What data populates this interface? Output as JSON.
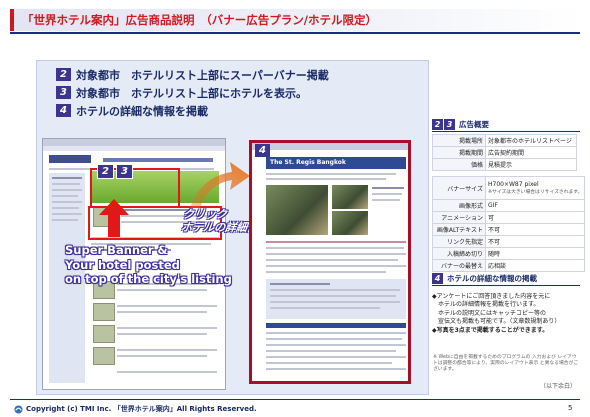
{
  "title": "「世界ホテル案内」広告商品説明　（バナー広告プラン/ホテル限定）",
  "steps": [
    {
      "num": "2",
      "text": "対象都市　ホテルリスト上部にスーパーバナー掲載"
    },
    {
      "num": "3",
      "text": "対象都市　ホテルリスト上部にホテルを表示。"
    },
    {
      "num": "4",
      "text": "ホテルの詳細な情報を掲載"
    }
  ],
  "left_screenshot": {
    "nums": [
      "2",
      "3"
    ]
  },
  "right_screenshot": {
    "num": "4",
    "hotel_name": "The St. Regis Bangkok"
  },
  "overlay": {
    "super_banner": [
      "Super Banner &",
      "Your hotel posted",
      "on top of the city's listing"
    ],
    "click": [
      "クリック",
      "ホテルの詳細情報を表示"
    ]
  },
  "overview": {
    "nums": [
      "2",
      "3"
    ],
    "heading": "広告概要",
    "rows": [
      {
        "k": "掲載場所",
        "v": "対象都市のホテルリストページ"
      },
      {
        "k": "掲載期間",
        "v": "広告契約期間"
      },
      {
        "k": "価格",
        "v": "見積提示"
      },
      {
        "k": "バナーサイズ",
        "v": "H700×W87 pixel",
        "note": "※サイズは大きい場合はリサイズされます。"
      },
      {
        "k": "画像形式",
        "v": "GIF"
      },
      {
        "k": "アニメーション",
        "v": "可"
      },
      {
        "k": "画像ALTテキスト",
        "v": "不可"
      },
      {
        "k": "リンク先指定",
        "v": "不可"
      },
      {
        "k": "入稿締め切り",
        "v": "随時"
      },
      {
        "k": "バナーの最替え",
        "v": "応相談"
      }
    ]
  },
  "details": {
    "num": "4",
    "heading": "ホテルの詳細な情報の掲載",
    "bullets": [
      "◆アンケートにご回答頂きました内容を元に",
      "　ホテルの詳細情報を掲載を行います。",
      "　ホテルの説明文にはキャッチコピー等の",
      "　宣伝文も掲載も可能です。（文章数規制あり）",
      "◆写真を3点まで掲載することができます。"
    ],
    "fine_print": "※ Webに自由を掲載するためのプログラムの 入力および レイアウトは調整の都合等により、実際のレイアウト表示 と異なる場合がございます。",
    "continued": "（以下余白）"
  },
  "footer": {
    "copyright": "Copyright (c) TMI Inc. 「世界ホテル案内」All Rights Reserved.",
    "page": "5"
  },
  "colors": {
    "accent_red": "#d01a22",
    "navy": "#1c2c86",
    "badge": "#3d3490",
    "frame_red": "#a50f2a"
  }
}
